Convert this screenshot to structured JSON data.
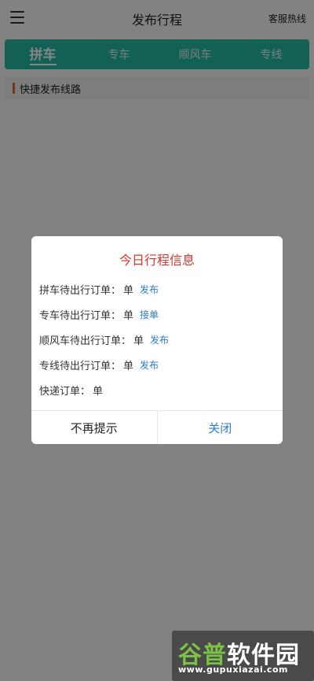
{
  "header": {
    "title": "发布行程",
    "hotline_label": "客服热线",
    "menu_icon": "hamburger-menu-icon"
  },
  "tabs": [
    {
      "label": "拼车",
      "active": true
    },
    {
      "label": "专车",
      "active": false
    },
    {
      "label": "顺风车",
      "active": false
    },
    {
      "label": "专线",
      "active": false
    }
  ],
  "quick_route": {
    "label": "快捷发布线路"
  },
  "modal": {
    "title": "今日行程信息",
    "orders": [
      {
        "label": "拼车待出行订单：",
        "unit": "单",
        "action": "发布"
      },
      {
        "label": "专车待出行订单：",
        "unit": "单",
        "action": "接单"
      },
      {
        "label": "顺风车待出行订单：",
        "unit": "单",
        "action": "发布"
      },
      {
        "label": "专线待出行订单：",
        "unit": "单",
        "action": "发布"
      },
      {
        "label": "快递订单：",
        "unit": "单",
        "action": ""
      }
    ],
    "dismiss_label": "不再提示",
    "close_label": "关闭"
  },
  "watermark": {
    "brand_part1": "谷普",
    "brand_part2": "软件园",
    "url": "www.gupuxiazai.com"
  },
  "colors": {
    "tab_bar": "#26b9a1",
    "modal_title": "#d7352f",
    "link": "#2f7ad0",
    "quick_accent": "#e07020"
  }
}
